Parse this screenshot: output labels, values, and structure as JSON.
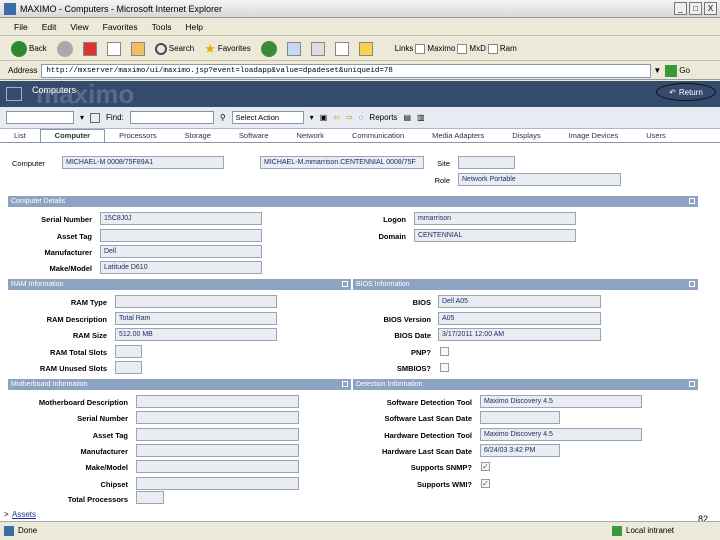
{
  "window": {
    "title": "MAXIMO - Computers - Microsoft Internet Explorer",
    "btn_min": "_",
    "btn_max": "□",
    "btn_close": "X"
  },
  "menubar": [
    "File",
    "Edit",
    "View",
    "Favorites",
    "Tools",
    "Help"
  ],
  "toolbar": {
    "back": "Back",
    "search": "Search",
    "favorites": "Favorites",
    "links": "Links",
    "link1": "Maximo",
    "link2": "MxD",
    "link3": "Ram"
  },
  "address": {
    "label": "Address",
    "url": "http://mxserver/maximo/ui/maximo.jsp?event=loadapp&value=dpadeset&uniqueid=78",
    "go": "Go"
  },
  "app": {
    "name": "Computers",
    "brand": "maximo",
    "return": "Return"
  },
  "mx_toolbar": {
    "find_label": "Find:",
    "action": "Select Action",
    "reports": "Reports"
  },
  "tabs": [
    "List",
    "Computer",
    "Processors",
    "Storage",
    "Software",
    "Network",
    "Communication",
    "Media Adapters",
    "Displays",
    "Image Devices",
    "Users"
  ],
  "header": {
    "computer_label": "Computer",
    "computer_value": "MICHAEL-M 0008/75F89A1",
    "computer_desc": "MICHAEL-M.mmarrison.CENTENNIAL 0008/75F",
    "site_label": "Site",
    "site_value": "",
    "role_label": "Role",
    "role_value": "Network Portable"
  },
  "computer_details": {
    "title": "Computer Details",
    "serial_label": "Serial Number",
    "serial_value": "15C8J0J",
    "asset_label": "Asset Tag",
    "asset_value": "",
    "manufacturer_label": "Manufacturer",
    "manufacturer_value": "Dell",
    "model_label": "Make/Model",
    "model_value": "Latitude D610",
    "logon_label": "Logon",
    "logon_value": "mmarrison",
    "domain_label": "Domain",
    "domain_value": "CENTENNIAL"
  },
  "ram": {
    "title": "RAM Information",
    "type_label": "RAM Type",
    "type_value": "",
    "desc_label": "RAM Description",
    "desc_value": "Total Ram",
    "size_label": "RAM Size",
    "size_value": "512.00 MB",
    "total_label": "RAM Total Slots",
    "total_value": "",
    "unused_label": "RAM Unused Slots",
    "unused_value": ""
  },
  "bios": {
    "title": "BIOS Information",
    "bios_label": "BIOS",
    "bios_value": "Dell A05",
    "version_label": "BIOS Version",
    "version_value": "A05",
    "date_label": "BIOS Date",
    "date_value": "3/17/2011 12:00 AM",
    "pnp_label": "PNP?",
    "smbios_label": "SMBIOS?"
  },
  "motherboard": {
    "title": "Motherboard Information",
    "desc_label": "Motherboard Description",
    "serial_label": "Serial Number",
    "asset_label": "Asset Tag",
    "manufacturer_label": "Manufacturer",
    "model_label": "Make/Model",
    "chipset_label": "Chipset",
    "processors_label": "Total Processors"
  },
  "detection": {
    "title": "Detection Information",
    "sw_tool_label": "Software Detection Tool",
    "sw_tool_value": "Maximo Discovery 4.5",
    "sw_date_label": "Software Last Scan Date",
    "sw_date_value": "",
    "hw_tool_label": "Hardware Detection Tool",
    "hw_tool_value": "Maximo Discovery 4.5",
    "hw_date_label": "Hardware Last Scan Date",
    "hw_date_value": "6/24/03 3:42 PM",
    "snmp_label": "Supports SNMP?",
    "snmp_checked": "✓",
    "wmi_label": "Supports WMI?",
    "wmi_checked": "✓"
  },
  "page_footer": {
    "assets_link": "Assets",
    "slide_number": "82"
  },
  "status": {
    "done": "Done",
    "zone": "Local intranet"
  }
}
